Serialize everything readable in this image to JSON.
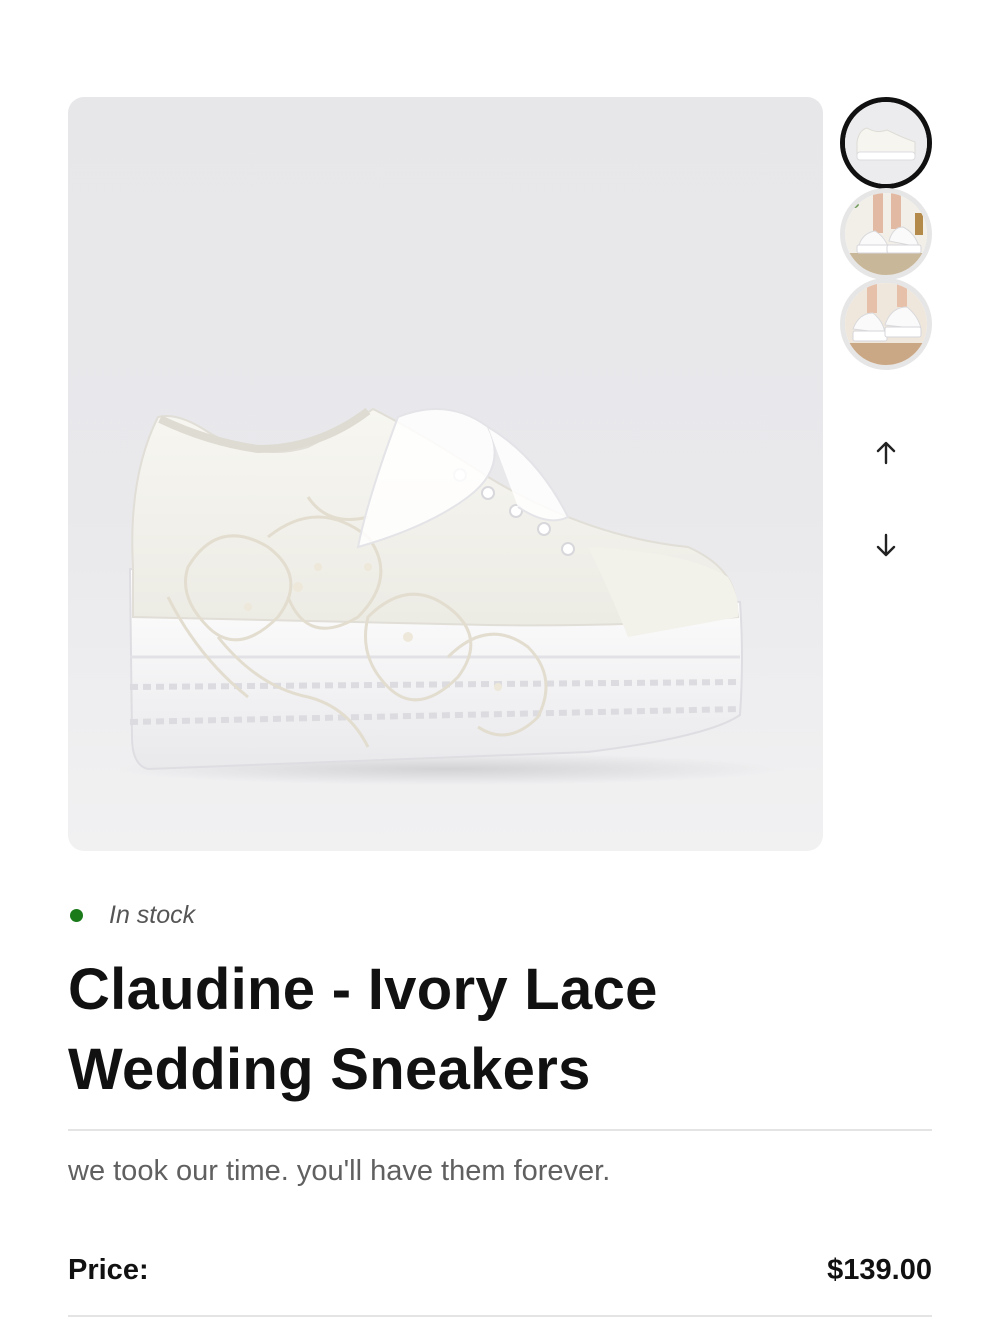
{
  "product": {
    "stock_status": "In stock",
    "title": "Claudine - Ivory Lace Wedding Sneakers",
    "tagline": "we took our time. you'll have them forever.",
    "price_label": "Price:",
    "price_value": "$139.00"
  },
  "gallery": {
    "main_image": "ivory-lace-platform-sneaker",
    "thumbnails": [
      {
        "name": "sneaker-side-view",
        "active": true
      },
      {
        "name": "sneakers-worn-standing",
        "active": false
      },
      {
        "name": "sneakers-worn-closeup",
        "active": false
      }
    ],
    "nav": {
      "up_icon": "arrow-up-icon",
      "down_icon": "arrow-down-icon"
    }
  },
  "colors": {
    "stock_dot": "#1a7a1a",
    "active_thumb_border": "#111111",
    "inactive_thumb_border": "#e6e6e6"
  }
}
